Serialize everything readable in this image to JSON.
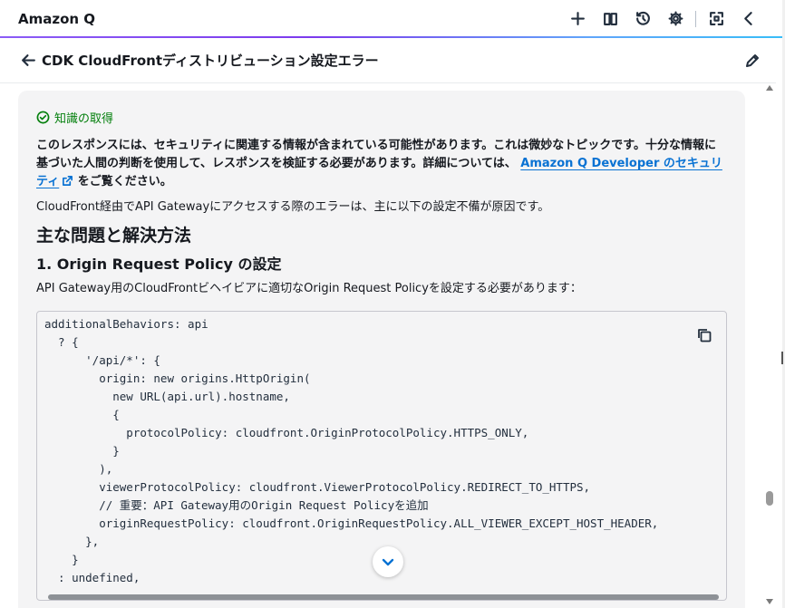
{
  "app": {
    "title": "Amazon Q"
  },
  "toolbar": {
    "tools": [
      {
        "name": "new-chat-button",
        "icon": "plus-icon"
      },
      {
        "name": "prompt-library-button",
        "icon": "book-icon"
      },
      {
        "name": "history-button",
        "icon": "history-icon"
      },
      {
        "name": "settings-button",
        "icon": "gear-icon"
      },
      {
        "name": "fullscreen-button",
        "icon": "expand-icon"
      },
      {
        "name": "collapse-panel-button",
        "icon": "chevron-left-icon"
      }
    ]
  },
  "conversation": {
    "title": "CDK CloudFrontディストリビューション設定エラー"
  },
  "message": {
    "acknowledgement": "知識の取得",
    "warning_text": "このレスポンスには、セキュリティに関連する情報が含まれている可能性があります。これは微妙なトピックです。十分な情報に基づいた人間の判断を使用して、レスポンスを検証する必要があります。詳細については、",
    "warning_link": "Amazon Q Developer のセキュリティ",
    "warning_suffix": "をご覧ください。",
    "intro": "CloudFront経由でAPI Gatewayにアクセスする際のエラーは、主に以下の設定不備が原因です。",
    "heading_main": "主な問題と解決方法",
    "heading_sub": "1. Origin Request Policy の設定",
    "sub_intro": "API Gateway用のCloudFrontビヘイビアに適切なOrigin Request Policyを設定する必要があります：",
    "code_lines": [
      "additionalBehaviors: api",
      "  ? {",
      "      '/api/*': {",
      "        origin: new origins.HttpOrigin(",
      "          new URL(api.url).hostname,",
      "          {",
      "            protocolPolicy: cloudfront.OriginProtocolPolicy.HTTPS_ONLY,",
      "          }",
      "        ),",
      "        viewerProtocolPolicy: cloudfront.ViewerProtocolPolicy.REDIRECT_TO_HTTPS,",
      "        // 重要：API Gateway用のOrigin Request Policyを追加",
      "        originRequestPolicy: cloudfront.OriginRequestPolicy.ALL_VIEWER_EXCEPT_HOST_HEADER,",
      "      },",
      "    }",
      "  : undefined,"
    ]
  },
  "colors": {
    "accent_link": "#0972d3",
    "success_green": "#037f0c",
    "card_background": "#f4f4f5",
    "header_gradient_start": "#8b5cf6",
    "header_gradient_end": "#38bdf8"
  }
}
